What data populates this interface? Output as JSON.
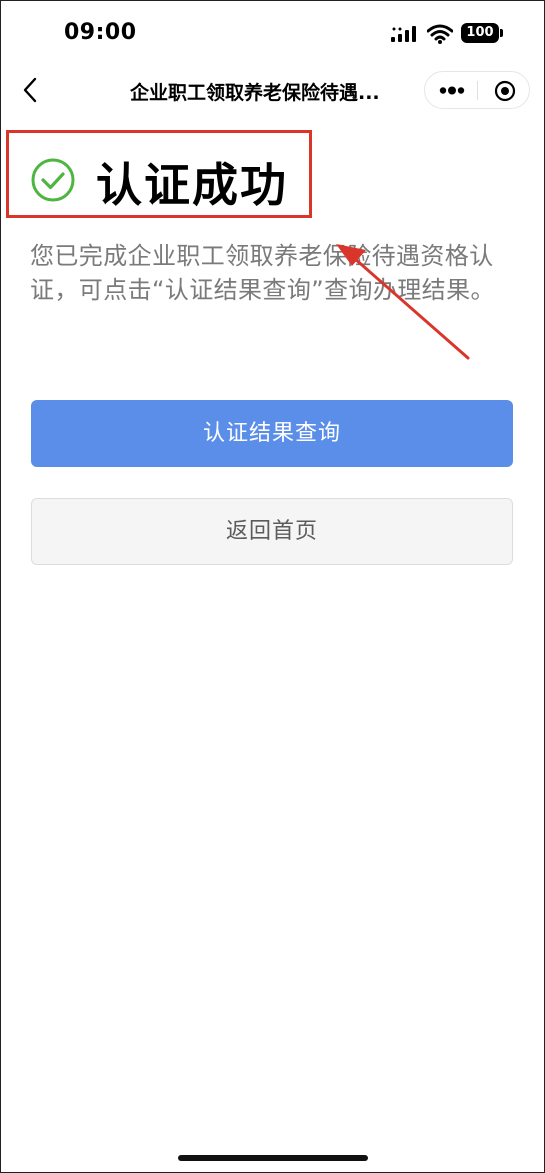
{
  "status_bar": {
    "time": "09:00",
    "battery": "100",
    "icons": [
      "signal-icon",
      "wifi-icon",
      "battery-icon"
    ]
  },
  "nav": {
    "title": "企业职工领取养老保险待遇...",
    "icons": [
      "back-icon",
      "more-icon",
      "target-icon"
    ]
  },
  "result": {
    "title": "认证成功",
    "description": "您已完成企业职工领取养老保险待遇资格认证，可点击“认证结果查询”查询办理结果。",
    "icon": "check-circle-icon"
  },
  "actions": {
    "primary_label": "认证结果查询",
    "secondary_label": "返回首页"
  },
  "colors": {
    "primary": "#5b8ee8",
    "success": "#4cb63f",
    "annotation": "#d9352a",
    "text_secondary": "#7a7a7a"
  }
}
